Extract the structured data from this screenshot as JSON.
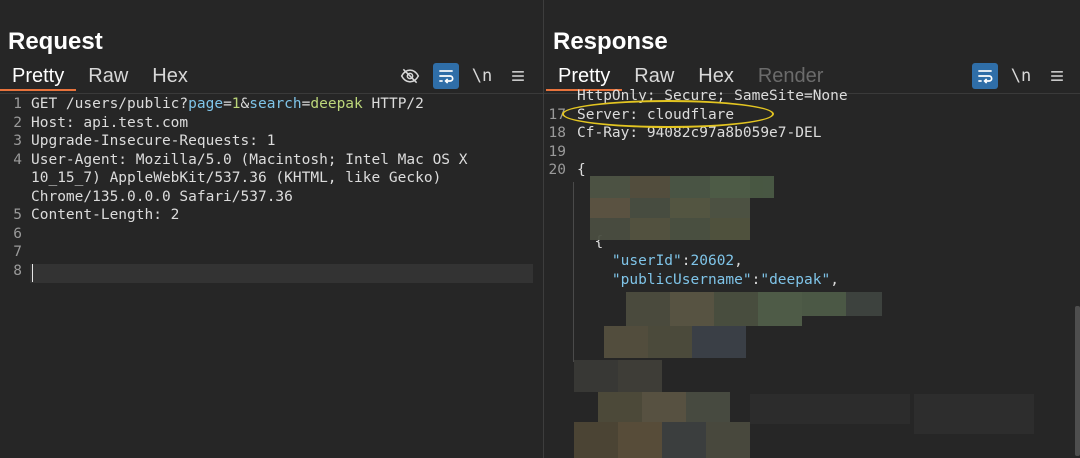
{
  "request": {
    "title": "Request",
    "tabs": [
      "Pretty",
      "Raw",
      "Hex"
    ],
    "tools": {
      "newline": "\\n"
    },
    "lines": [
      {
        "num": "1",
        "parts": [
          {
            "t": "GET /users/public?",
            "c": "key"
          },
          {
            "t": "page",
            "c": "param"
          },
          {
            "t": "=",
            "c": "key"
          },
          {
            "t": "1",
            "c": "val"
          },
          {
            "t": "&",
            "c": "key"
          },
          {
            "t": "search",
            "c": "param"
          },
          {
            "t": "=",
            "c": "key"
          },
          {
            "t": "deepak",
            "c": "val"
          },
          {
            "t": " HTTP/2",
            "c": "key"
          }
        ]
      },
      {
        "num": "2",
        "parts": [
          {
            "t": "Host: api.test.com",
            "c": "key"
          }
        ]
      },
      {
        "num": "3",
        "parts": [
          {
            "t": "Upgrade-Insecure-Requests: 1",
            "c": "key"
          }
        ]
      },
      {
        "num": "4",
        "parts": [
          {
            "t": "User-Agent: Mozilla/5.0 (Macintosh; Intel Mac OS X",
            "c": "key"
          }
        ]
      },
      {
        "num": "",
        "parts": [
          {
            "t": "10_15_7) AppleWebKit/537.36 (KHTML, like Gecko)",
            "c": "key"
          }
        ]
      },
      {
        "num": "",
        "parts": [
          {
            "t": "Chrome/135.0.0.0 Safari/537.36",
            "c": "key"
          }
        ]
      },
      {
        "num": "5",
        "parts": [
          {
            "t": "Content-Length: 2",
            "c": "key"
          }
        ]
      },
      {
        "num": "6",
        "parts": []
      },
      {
        "num": "7",
        "parts": []
      },
      {
        "num": "8",
        "parts": []
      }
    ]
  },
  "response": {
    "title": "Response",
    "tabs": [
      "Pretty",
      "Raw",
      "Hex",
      "Render"
    ],
    "tools": {
      "newline": "\\n"
    },
    "lines": [
      {
        "num": "",
        "parts": [
          {
            "t": "HttpOnly; Secure; SameSite=None",
            "c": "key"
          }
        ]
      },
      {
        "num": "17",
        "parts": [
          {
            "t": "Server: cloudflare",
            "c": "key"
          }
        ]
      },
      {
        "num": "18",
        "parts": [
          {
            "t": "Cf-Ray: 94082c97a8b059e7-DEL",
            "c": "key"
          }
        ]
      },
      {
        "num": "19",
        "parts": []
      },
      {
        "num": "20",
        "parts": [
          {
            "t": "{",
            "c": "key"
          }
        ]
      }
    ],
    "body_lines": [
      {
        "parts": [
          {
            "t": "  {",
            "c": "key"
          }
        ]
      },
      {
        "parts": [
          {
            "t": "    ",
            "c": "key"
          },
          {
            "t": "\"userId\"",
            "c": "str"
          },
          {
            "t": ":",
            "c": "key"
          },
          {
            "t": "20602",
            "c": "num"
          },
          {
            "t": ",",
            "c": "key"
          }
        ]
      },
      {
        "parts": [
          {
            "t": "    ",
            "c": "key"
          },
          {
            "t": "\"publicUsername\"",
            "c": "str"
          },
          {
            "t": ":",
            "c": "key"
          },
          {
            "t": "\"deepak\"",
            "c": "str"
          },
          {
            "t": ",",
            "c": "key"
          }
        ]
      }
    ]
  },
  "colors": {
    "background": "#262626",
    "active_tab_underline": "#e8733c",
    "toggle_active": "#2f6ea8",
    "highlight_ring": "#e3c521"
  }
}
